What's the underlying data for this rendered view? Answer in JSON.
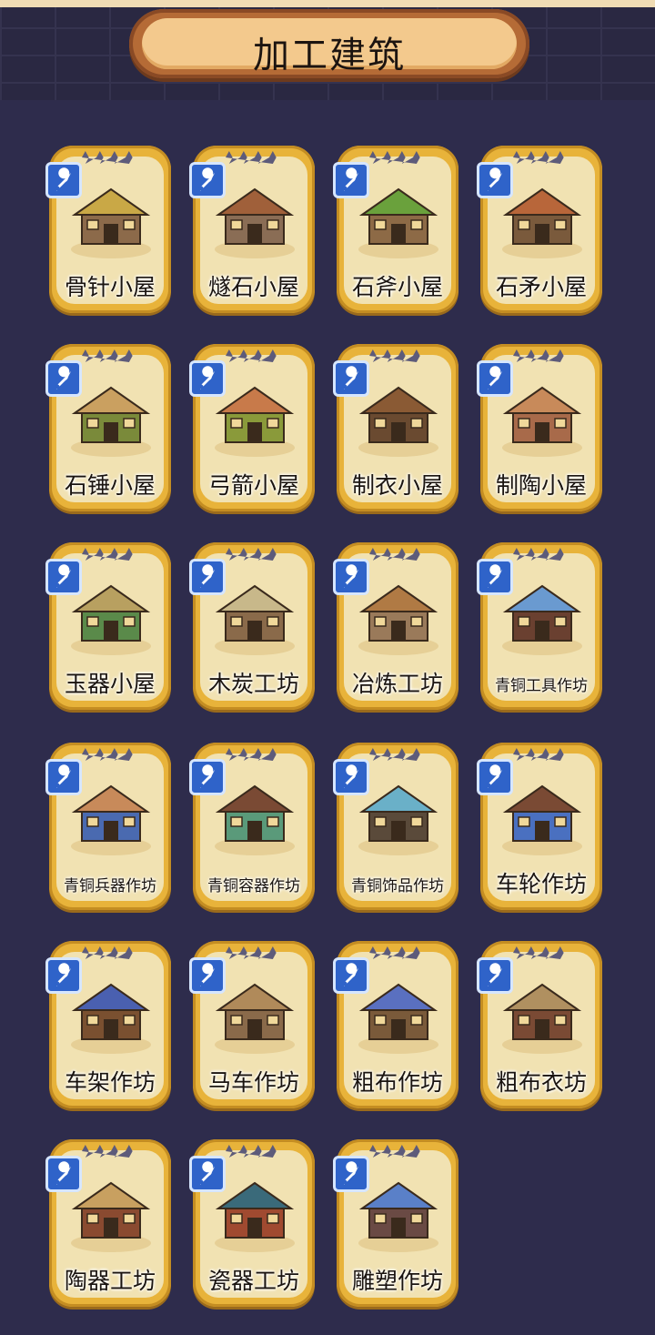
{
  "header": {
    "title": "加工建筑"
  },
  "buildings": [
    {
      "name": "骨针小屋",
      "roof": "#c9a846",
      "body": "#8c6a4a"
    },
    {
      "name": "燧石小屋",
      "roof": "#a0603a",
      "body": "#8a6d55"
    },
    {
      "name": "石斧小屋",
      "roof": "#6aa13c",
      "body": "#8d6a46"
    },
    {
      "name": "石矛小屋",
      "roof": "#b8663a",
      "body": "#7a5a3c"
    },
    {
      "name": "石锤小屋",
      "roof": "#caa060",
      "body": "#7a8a3a"
    },
    {
      "name": "弓箭小屋",
      "roof": "#c87a4a",
      "body": "#8a9a3a"
    },
    {
      "name": "制衣小屋",
      "roof": "#8a5a34",
      "body": "#6a4a30"
    },
    {
      "name": "制陶小屋",
      "roof": "#c88a5a",
      "body": "#a86a4a"
    },
    {
      "name": "玉器小屋",
      "roof": "#b8a060",
      "body": "#5a8a4a"
    },
    {
      "name": "木炭工坊",
      "roof": "#c8b88a",
      "body": "#8a6a4a"
    },
    {
      "name": "冶炼工坊",
      "roof": "#b07a44",
      "body": "#9a7a5a"
    },
    {
      "name": "青铜工具作坊",
      "roof": "#6a9ad0",
      "body": "#6a4030"
    },
    {
      "name": "青铜兵器作坊",
      "roof": "#c88a5a",
      "body": "#4a6ab0"
    },
    {
      "name": "青铜容器作坊",
      "roof": "#7a4a34",
      "body": "#5a9a7a"
    },
    {
      "name": "青铜饰品作坊",
      "roof": "#6ab0c8",
      "body": "#5a4a3a"
    },
    {
      "name": "车轮作坊",
      "roof": "#7a4a34",
      "body": "#4a70c0"
    },
    {
      "name": "车架作坊",
      "roof": "#4a60b0",
      "body": "#7a5030"
    },
    {
      "name": "马车作坊",
      "roof": "#b08a5a",
      "body": "#8a6a4a"
    },
    {
      "name": "粗布作坊",
      "roof": "#5a70c0",
      "body": "#7a5a3a"
    },
    {
      "name": "粗布衣坊",
      "roof": "#b09060",
      "body": "#7a4a34"
    },
    {
      "name": "陶器工坊",
      "roof": "#c8a060",
      "body": "#8a4a30"
    },
    {
      "name": "瓷器工坊",
      "roof": "#3a6a7a",
      "body": "#a04a30"
    },
    {
      "name": "雕塑作坊",
      "roof": "#5a80c8",
      "body": "#6a4a44"
    }
  ],
  "icons": {
    "upgrade": "wrench-icon"
  }
}
